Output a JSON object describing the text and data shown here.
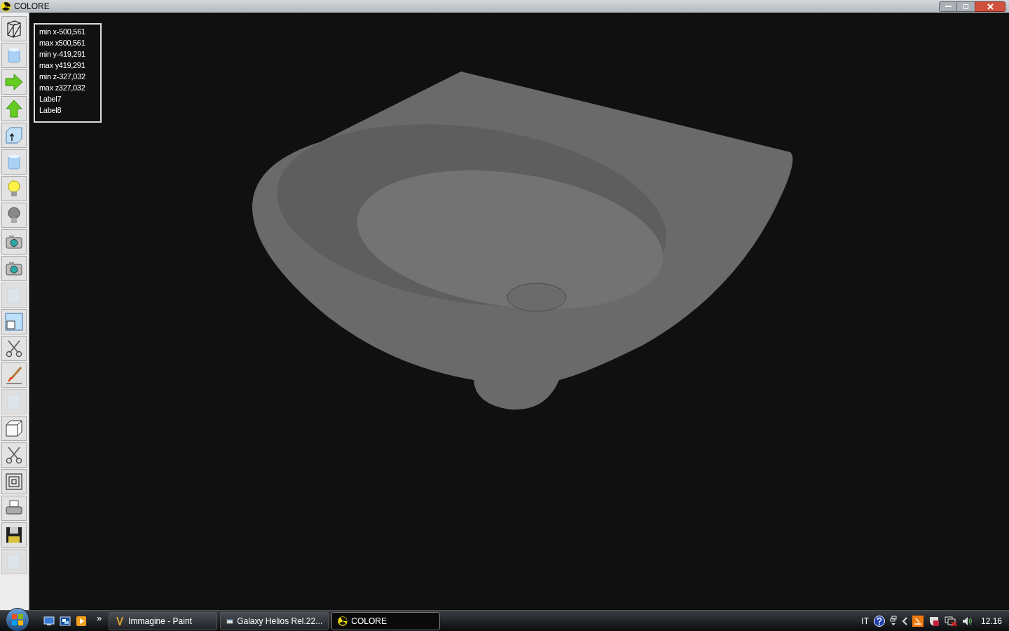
{
  "window": {
    "title": "COLORE"
  },
  "tools": [
    {
      "kind": "wireframe",
      "disabled": false
    },
    {
      "kind": "cylinder",
      "disabled": false
    },
    {
      "kind": "arrow-right",
      "disabled": false
    },
    {
      "kind": "arrow-up",
      "disabled": false
    },
    {
      "kind": "cube-arrow",
      "disabled": false
    },
    {
      "kind": "cylinder",
      "disabled": false
    },
    {
      "kind": "bulb-on",
      "disabled": false
    },
    {
      "kind": "bulb-off",
      "disabled": false
    },
    {
      "kind": "camera",
      "disabled": false
    },
    {
      "kind": "camera",
      "disabled": false
    },
    {
      "kind": "blank",
      "disabled": true
    },
    {
      "kind": "window",
      "disabled": false
    },
    {
      "kind": "scissors",
      "disabled": false
    },
    {
      "kind": "brush",
      "disabled": false
    },
    {
      "kind": "blank",
      "disabled": true
    },
    {
      "kind": "cube",
      "disabled": false
    },
    {
      "kind": "scissors",
      "disabled": false
    },
    {
      "kind": "squares",
      "disabled": false
    },
    {
      "kind": "printer",
      "disabled": false
    },
    {
      "kind": "floppy",
      "disabled": false
    },
    {
      "kind": "blank",
      "disabled": true
    }
  ],
  "info_labels": [
    "min x-500,561",
    "max x500,561",
    "min y-419,291",
    "max y419,291",
    "min z-327,032",
    "max z327,032",
    "Label7",
    "Label8"
  ],
  "taskbar": {
    "tasks": [
      {
        "label": "Immagine - Paint",
        "kind": "paint",
        "selected": false
      },
      {
        "label": "Galaxy Helios  Rel.22...",
        "kind": "helios",
        "selected": false
      },
      {
        "label": "COLORE",
        "kind": "colore",
        "selected": true
      }
    ],
    "overflow": "»",
    "language": "IT",
    "clock": "12.16"
  }
}
